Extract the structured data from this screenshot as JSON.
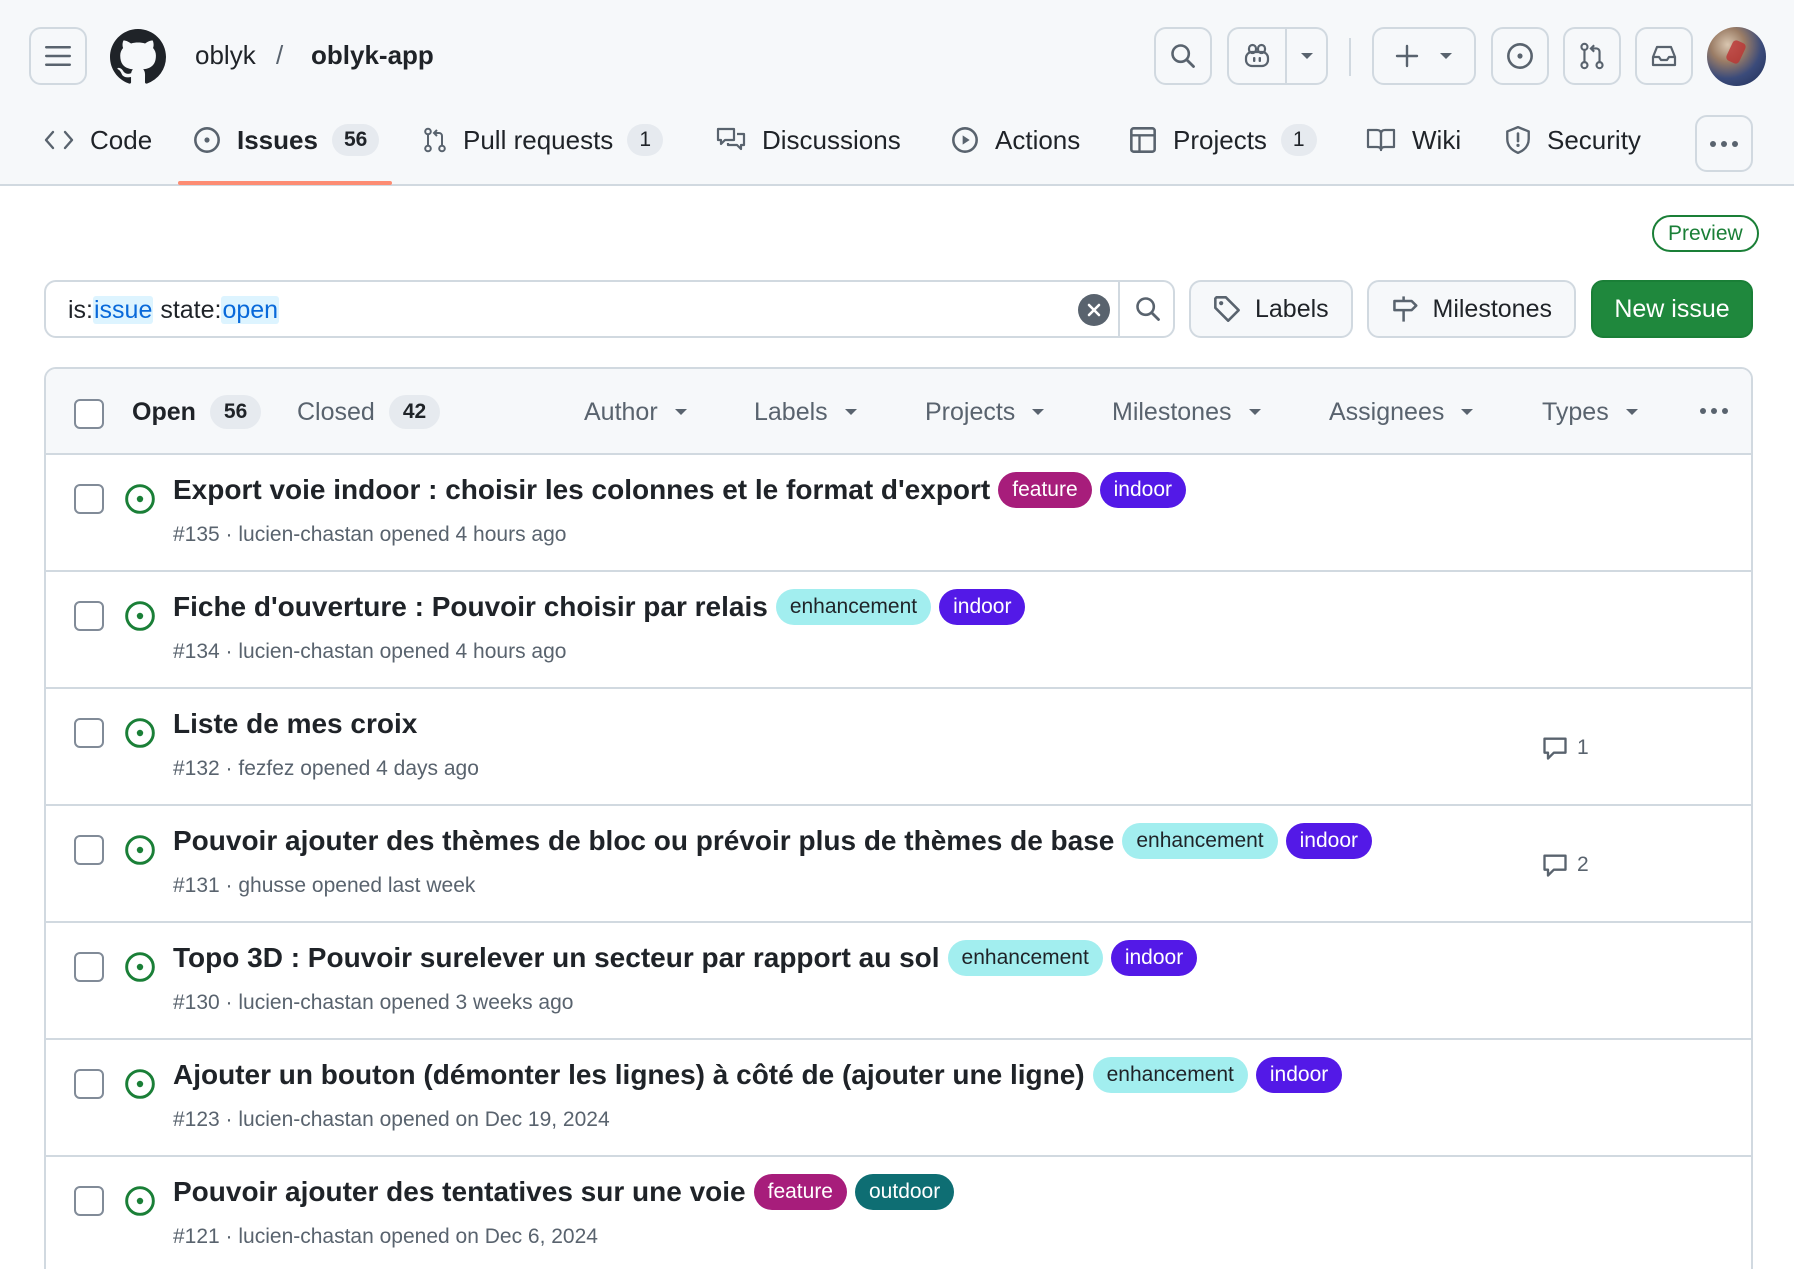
{
  "repo": {
    "owner": "oblyk",
    "separator": "/",
    "name": "oblyk-app"
  },
  "nav": {
    "tabs": [
      {
        "label": "Code"
      },
      {
        "label": "Issues",
        "count": "56"
      },
      {
        "label": "Pull requests",
        "count": "1"
      },
      {
        "label": "Discussions"
      },
      {
        "label": "Actions"
      },
      {
        "label": "Projects",
        "count": "1"
      },
      {
        "label": "Wiki"
      },
      {
        "label": "Security"
      }
    ],
    "selected": "Issues"
  },
  "preview_badge": "Preview",
  "search": {
    "prefix1": "is:",
    "value1": "issue",
    "prefix2": " state:",
    "value2": "open"
  },
  "actions": {
    "labels": "Labels",
    "milestones": "Milestones",
    "new_issue": "New issue"
  },
  "list": {
    "open_label": "Open",
    "open_count": "56",
    "closed_label": "Closed",
    "closed_count": "42",
    "filters": [
      "Author",
      "Labels",
      "Projects",
      "Milestones",
      "Assignees",
      "Types"
    ]
  },
  "issues": [
    {
      "title": "Export voie indoor : choisir les colonnes et le format d'export",
      "labels": [
        {
          "name": "feature",
          "bg": "#a71d7b",
          "fg": "#ffffff"
        },
        {
          "name": "indoor",
          "bg": "#5319e7",
          "fg": "#ffffff"
        }
      ],
      "meta": "#135 · lucien-chastan opened 4 hours ago",
      "comments": ""
    },
    {
      "title": "Fiche d'ouverture : Pouvoir choisir par relais",
      "labels": [
        {
          "name": "enhancement",
          "bg": "#a2eeef",
          "fg": "#1f2328"
        },
        {
          "name": "indoor",
          "bg": "#5319e7",
          "fg": "#ffffff"
        }
      ],
      "meta": "#134 · lucien-chastan opened 4 hours ago",
      "comments": ""
    },
    {
      "title": "Liste de mes croix",
      "labels": [],
      "meta": "#132 · fezfez opened 4 days ago",
      "comments": "1"
    },
    {
      "title": "Pouvoir ajouter des thèmes de bloc ou prévoir plus de thèmes de base",
      "labels": [
        {
          "name": "enhancement",
          "bg": "#a2eeef",
          "fg": "#1f2328"
        },
        {
          "name": "indoor",
          "bg": "#5319e7",
          "fg": "#ffffff"
        }
      ],
      "meta": "#131 · ghusse opened last week",
      "comments": "2"
    },
    {
      "title": "Topo 3D : Pouvoir surelever un secteur par rapport au sol",
      "labels": [
        {
          "name": "enhancement",
          "bg": "#a2eeef",
          "fg": "#1f2328"
        },
        {
          "name": "indoor",
          "bg": "#5319e7",
          "fg": "#ffffff"
        }
      ],
      "meta": "#130 · lucien-chastan opened 3 weeks ago",
      "comments": ""
    },
    {
      "title": "Ajouter un bouton (démonter les lignes) à côté de (ajouter une ligne)",
      "labels": [
        {
          "name": "enhancement",
          "bg": "#a2eeef",
          "fg": "#1f2328"
        },
        {
          "name": "indoor",
          "bg": "#5319e7",
          "fg": "#ffffff"
        }
      ],
      "meta": "#123 · lucien-chastan opened on Dec 19, 2024",
      "comments": ""
    },
    {
      "title": "Pouvoir ajouter des tentatives sur une voie",
      "labels": [
        {
          "name": "feature",
          "bg": "#a71d7b",
          "fg": "#ffffff"
        },
        {
          "name": "outdoor",
          "bg": "#0e6e73",
          "fg": "#ffffff"
        }
      ],
      "meta": "#121 · lucien-chastan opened on Dec 6, 2024",
      "comments": ""
    }
  ],
  "colors": {
    "accent_green": "#1f883d",
    "open_icon": "#1a7f37",
    "tab_underline": "#fd8c73",
    "link_blue": "#0969da"
  },
  "icons": [
    "hamburger-icon",
    "github-logo-icon",
    "search-icon",
    "copilot-icon",
    "plus-icon",
    "issue-opened-icon",
    "pull-request-icon",
    "inbox-icon",
    "code-icon",
    "comment-discussion-icon",
    "play-icon",
    "table-icon",
    "book-icon",
    "shield-icon",
    "kebab-icon",
    "x-circle-icon",
    "tag-icon",
    "milestone-icon",
    "triangle-down-icon",
    "comment-icon"
  ]
}
